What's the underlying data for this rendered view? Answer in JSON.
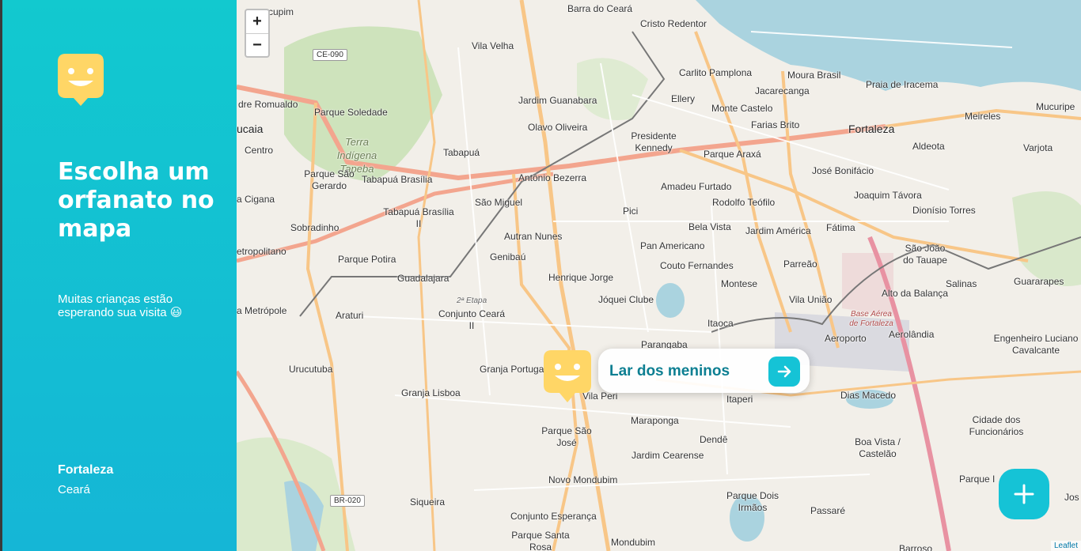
{
  "sidebar": {
    "title": "Escolha um orfanato no mapa",
    "subtitle": "Muitas crianças estão esperando sua visita 😃",
    "city": "Fortaleza",
    "state": "Ceará"
  },
  "map": {
    "zoom_in": "+",
    "zoom_out": "−",
    "places": {
      "barra_do_ceara": "Barra do Ceará",
      "cristo_redentor": "Cristo Redentor",
      "vila_velha": "Vila Velha",
      "carlito_pamplona": "Carlito Pamplona",
      "moura_brasil": "Moura Brasil",
      "praia_de_iracema": "Praia de Iracema",
      "jacarecanga": "Jacarecanga",
      "ellery": "Ellery",
      "jardim_guanabara": "Jardim Guanabara",
      "monte_castelo": "Monte Castelo",
      "meireles": "Meireles",
      "mucuripe": "Mucuripe",
      "dre_romualdo": "dre Romualdo",
      "parque_soledade": "Parque Soledade",
      "olavo_oliveira": "Olavo Oliveira",
      "farias_brito": "Farias Brito",
      "fortaleza": "Fortaleza",
      "ucaia": "ucaia",
      "presidente_kennedy": "Presidente Kennedy",
      "aldeota": "Aldeota",
      "varjota": "Varjota",
      "terra_indigena": "Terra Indígena Tapeba",
      "centro": "Centro",
      "tabapua": "Tabapuá",
      "parque_araxa": "Parque Araxá",
      "parque_sao_gerardo": "Parque São Gerardo",
      "tabapua_brasilia": "Tabapuá Brasília",
      "antonio_bezerra": "Antônio Bezerra",
      "jose_bonifacio": "José Bonifácio",
      "amadeu_furtado": "Amadeu Furtado",
      "joaquim_tavora": "Joaquim Távora",
      "a_cigana": "a Cigana",
      "sao_miguel": "São Miguel",
      "rodolfo_teofilo": "Rodolfo Teófilo",
      "dionisio_torres": "Dionísio Torres",
      "tabapua_brasilia_ii": "Tabapuá Brasília II",
      "pici": "Pici",
      "sobradinho": "Sobradinho",
      "bela_vista": "Bela Vista",
      "jardim_america": "Jardim América",
      "fatima": "Fátima",
      "autran_nunes": "Autran Nunes",
      "etropolitano": "etropolitano",
      "pan_americano": "Pan Americano",
      "sao_joao_do_tauape": "São João do Tauape",
      "parque_potira": "Parque Potira",
      "genibau": "Genibaú",
      "couto_fernandes": "Couto Fernandes",
      "parreao": "Parreão",
      "guadalajara": "Guadalajara",
      "henrique_jorge": "Henrique Jorge",
      "montese": "Montese",
      "salinas": "Salinas",
      "guararapes": "Guararapes",
      "joquei_clube": "Jóquei Clube",
      "vila_uniao": "Vila União",
      "alto_da_balanca": "Alto da Balança",
      "segunda_etapa": "2ª Etapa",
      "a_metropole": "a Metrópole",
      "araturi": "Araturi",
      "conjunto_ceara_ii": "Conjunto Ceará II",
      "base_aerea": "Base Aérea de Fortaleza",
      "itaoca": "Itaoca",
      "aeroporto": "Aeroporto",
      "aerolandia": "Aerolândia",
      "engenheiro_luciano": "Engenheiro Luciano Cavalcante",
      "parangaba": "Parangaba",
      "urucutuba": "Urucutuba",
      "granja_portugal": "Granja Portugal",
      "granja_lisboa": "Granja Lisboa",
      "vila_peri": "Vila Peri",
      "itaperi": "Itaperi",
      "dias_macedo": "Dias Macedo",
      "maraponga": "Maraponga",
      "cidade_dos_funcionarios": "Cidade dos Funcionários",
      "parque_sao_jose": "Parque São José",
      "dende": "Dendê",
      "boa_vista_castelao": "Boa Vista / Castelão",
      "jardim_cearense": "Jardim Cearense",
      "novo_mondubim": "Novo Mondubim",
      "parque_dois_irmaos": "Parque Dois Irmãos",
      "parque_i": "Parque I",
      "siqueira": "Siqueira",
      "passare": "Passaré",
      "conjunto_esperanca": "Conjunto Esperança",
      "parque_santa_rosa": "Parque Santa Rosa",
      "mondubim": "Mondubim",
      "barroso": "Barroso",
      "jos": "Jos",
      "cupim": "cupim"
    },
    "roads": {
      "ce_090": "CE-090",
      "br_020": "BR-020"
    },
    "popup_label": "Lar dos meninos",
    "attribution": "Leaflet"
  },
  "colors": {
    "accent": "#15c3d6",
    "logo": "#ffd666",
    "popup_text": "#0d7f92"
  }
}
